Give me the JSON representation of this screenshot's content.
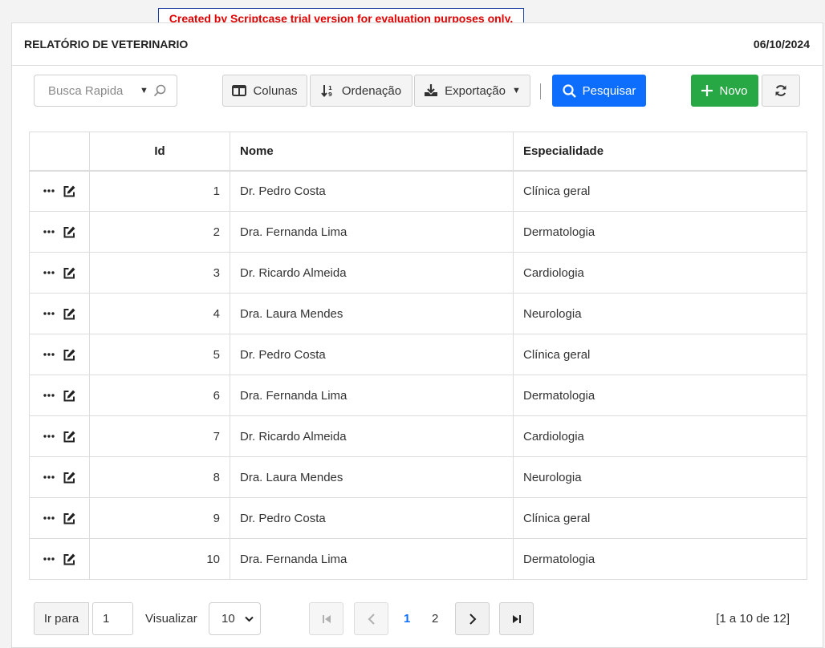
{
  "banner": "Created by Scriptcase trial version for evaluation purposes only.",
  "header": {
    "title": "RELATÓRIO DE VETERINARIO",
    "date": "06/10/2024"
  },
  "toolbar": {
    "quick_search_placeholder": "Busca Rapida",
    "columns_label": "Colunas",
    "sort_label": "Ordenação",
    "export_label": "Exportação",
    "search_label": "Pesquisar",
    "new_label": "Novo"
  },
  "table": {
    "headers": {
      "id": "Id",
      "name": "Nome",
      "specialty": "Especialidade"
    },
    "rows": [
      {
        "id": "1",
        "name": "Dr. Pedro Costa",
        "specialty": "Clínica geral"
      },
      {
        "id": "2",
        "name": "Dra. Fernanda Lima",
        "specialty": "Dermatologia"
      },
      {
        "id": "3",
        "name": "Dr. Ricardo Almeida",
        "specialty": "Cardiologia"
      },
      {
        "id": "4",
        "name": "Dra. Laura Mendes",
        "specialty": "Neurologia"
      },
      {
        "id": "5",
        "name": "Dr. Pedro Costa",
        "specialty": "Clínica geral"
      },
      {
        "id": "6",
        "name": "Dra. Fernanda Lima",
        "specialty": "Dermatologia"
      },
      {
        "id": "7",
        "name": "Dr. Ricardo Almeida",
        "specialty": "Cardiologia"
      },
      {
        "id": "8",
        "name": "Dra. Laura Mendes",
        "specialty": "Neurologia"
      },
      {
        "id": "9",
        "name": "Dr. Pedro Costa",
        "specialty": "Clínica geral"
      },
      {
        "id": "10",
        "name": "Dra. Fernanda Lima",
        "specialty": "Dermatologia"
      }
    ]
  },
  "footer": {
    "goto_label": "Ir para",
    "goto_value": "1",
    "view_label": "Visualizar",
    "page_size": "10",
    "pages": [
      "1",
      "2"
    ],
    "current_page": "1",
    "summary": "[1 a 10 de 12]"
  },
  "colors": {
    "primary": "#0d6efd",
    "success": "#28a745",
    "banner_text": "#e00000"
  }
}
